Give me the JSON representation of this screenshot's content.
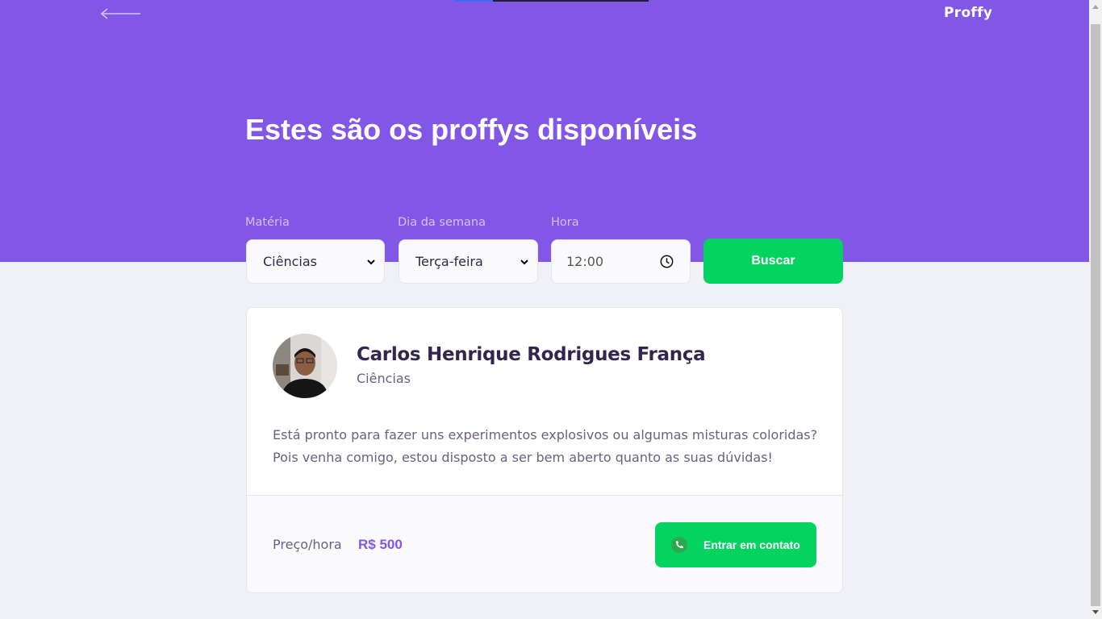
{
  "header": {
    "back_icon": "arrow-left-icon",
    "logo": "Proffy",
    "title": "Estes são os proffys disponíveis"
  },
  "filters": {
    "subject": {
      "label": "Matéria",
      "value": "Ciências"
    },
    "weekday": {
      "label": "Dia da semana",
      "value": "Terça-feira"
    },
    "time": {
      "label": "Hora",
      "value": "12:00"
    },
    "search_label": "Buscar"
  },
  "teacher": {
    "name": "Carlos Henrique Rodrigues França",
    "subject": "Ciências",
    "bio": "Está pronto para fazer uns experimentos explosivos ou algumas misturas coloridas? Pois venha comigo, estou disposto a ser bem aberto quanto as suas dúvidas!",
    "price_label": "Preço/hora",
    "price_value": "R$ 500",
    "contact_label": "Entrar em contato"
  },
  "colors": {
    "primary": "#8257e5",
    "secondary": "#04d361",
    "background": "#f0f0f7"
  }
}
